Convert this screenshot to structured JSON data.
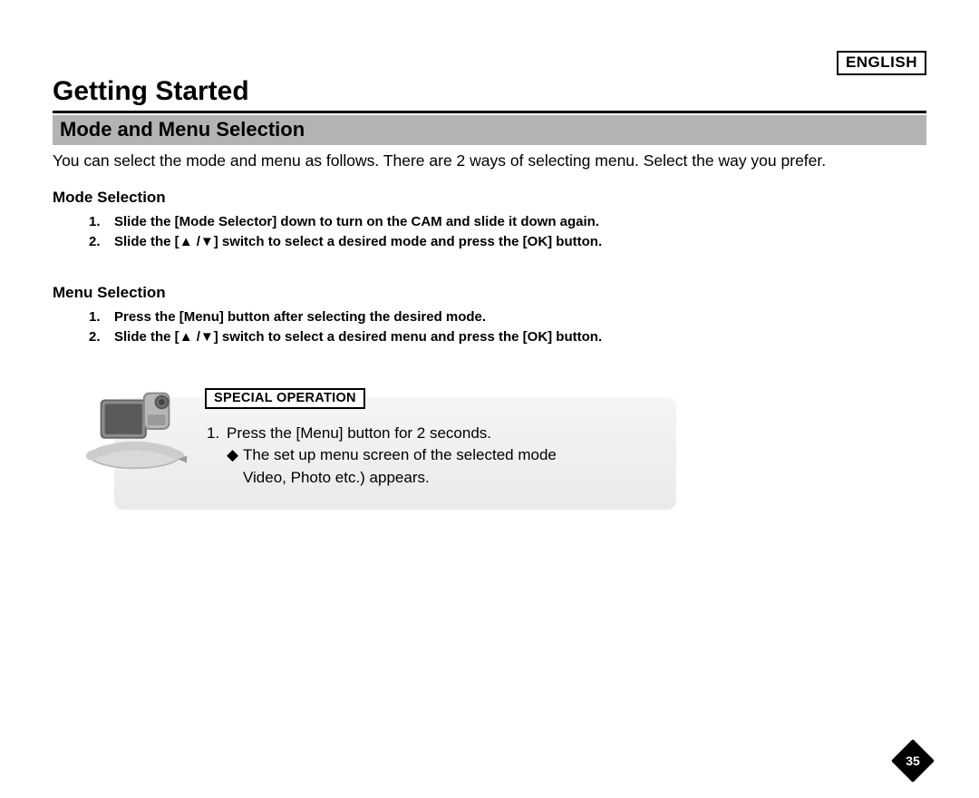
{
  "language_label": "ENGLISH",
  "page_title": "Getting Started",
  "section_bar": "Mode and Menu Selection",
  "intro": "You can select the mode and menu as follows. There are 2 ways of selecting menu. Select the way you prefer.",
  "mode_selection": {
    "heading": "Mode Selection",
    "steps": [
      {
        "n": "1.",
        "text_before": "Slide the [Mode Selector] down to turn on the CAM and slide it down again."
      },
      {
        "n": "2.",
        "text_before": "Slide the [",
        "arrows": "▲ /▼",
        "text_after": "] switch to select a desired mode and press the [OK] button."
      }
    ]
  },
  "menu_selection": {
    "heading": "Menu Selection",
    "steps": [
      {
        "n": "1.",
        "text_before": "Press the [Menu] button after selecting the desired mode."
      },
      {
        "n": "2.",
        "text_before": "Slide the [",
        "arrows": "▲ /▼",
        "text_after": "] switch to select a desired menu and press the [OK] button."
      }
    ]
  },
  "callout": {
    "label": "SPECIAL OPERATION",
    "n": "1.",
    "line1": "Press the [Menu] button for 2 seconds.",
    "sub_bullet": "◆",
    "line2a": "The set up menu screen of the selected mode",
    "line2b": "Video, Photo etc.) appears."
  },
  "page_number": "35"
}
